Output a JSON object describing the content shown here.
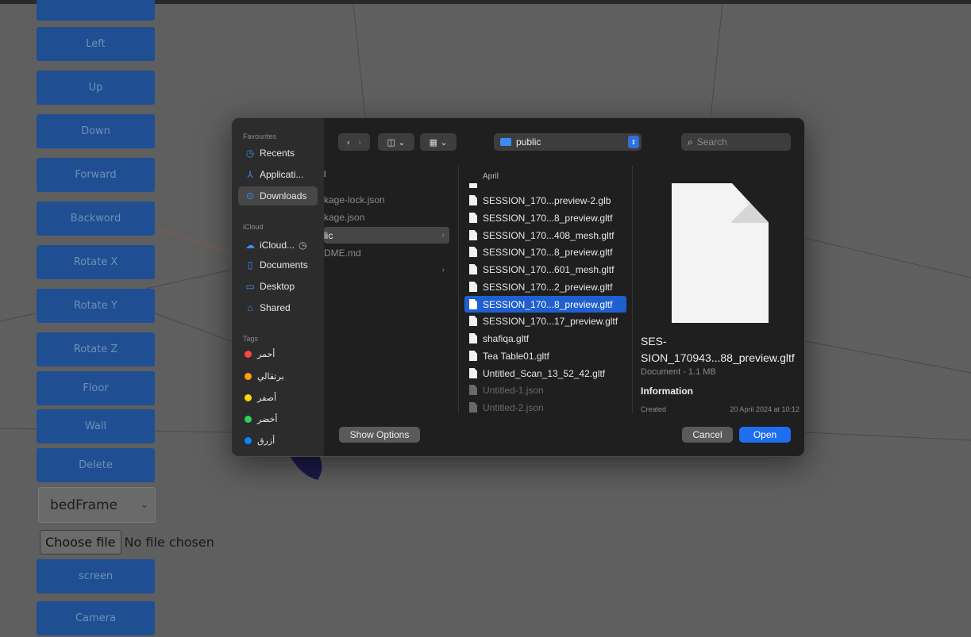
{
  "controls": {
    "buttons": [
      "Left",
      "Up",
      "Down",
      "Forward",
      "Backword",
      "Rotate X",
      "Rotate Y",
      "Rotate Z",
      "Floor",
      "Wall",
      "Delete"
    ],
    "select_value": "bedFrame",
    "choose_file_label": "Choose file",
    "no_file_text": "No file chosen",
    "screen_label": "screen",
    "camera_label": "Camera"
  },
  "dialog": {
    "sidebar": {
      "favourites_heading": "Favourites",
      "favourites": [
        {
          "label": "Recents",
          "icon": "clock-icon"
        },
        {
          "label": "Applicati...",
          "icon": "applications-icon"
        },
        {
          "label": "Downloads",
          "icon": "downloads-icon"
        }
      ],
      "icloud_heading": "iCloud",
      "icloud": [
        {
          "label": "iCloud...",
          "icon": "cloud-icon"
        },
        {
          "label": "Documents",
          "icon": "document-icon"
        },
        {
          "label": "Desktop",
          "icon": "desktop-icon"
        },
        {
          "label": "Shared",
          "icon": "shared-folder-icon"
        }
      ],
      "tags_heading": "Tags",
      "tags": [
        {
          "label": "أحمر",
          "color": "#ff453a"
        },
        {
          "label": "برتقالي",
          "color": "#ff9f0a"
        },
        {
          "label": "أصفر",
          "color": "#ffd60a"
        },
        {
          "label": "أخضر",
          "color": "#30d158"
        },
        {
          "label": "أزرق",
          "color": "#0a84ff"
        }
      ]
    },
    "location": "public",
    "search_placeholder": "Search",
    "column1": {
      "items": [
        {
          "label": "kage-lock.json",
          "selected": false
        },
        {
          "label": "kage.json",
          "selected": false
        },
        {
          "label": "lic",
          "selected": true
        },
        {
          "label": "DME.md",
          "selected": false
        }
      ]
    },
    "column2": {
      "heading": "April",
      "files": [
        {
          "label": "SESSION_170...preview-2.glb",
          "state": "normal"
        },
        {
          "label": "SESSION_170...8_preview.gltf",
          "state": "normal"
        },
        {
          "label": "SESSION_170...408_mesh.gltf",
          "state": "normal"
        },
        {
          "label": "SESSION_170...8_preview.gltf",
          "state": "normal"
        },
        {
          "label": "SESSION_170...601_mesh.gltf",
          "state": "normal"
        },
        {
          "label": "SESSION_170...2_preview.gltf",
          "state": "normal"
        },
        {
          "label": "SESSION_170...8_preview.gltf",
          "state": "selected"
        },
        {
          "label": "SESSION_170...17_preview.gltf",
          "state": "normal"
        },
        {
          "label": "shafiqa.gltf",
          "state": "normal"
        },
        {
          "label": "Tea Table01.gltf",
          "state": "normal"
        },
        {
          "label": "Untitled_Scan_13_52_42.gltf",
          "state": "normal"
        },
        {
          "label": "Untitled-1.json",
          "state": "dim"
        },
        {
          "label": "Untitled-2.json",
          "state": "dim"
        }
      ]
    },
    "preview": {
      "name": "SES-SION_170943...88_preview.gltf",
      "name_line1": "SES-",
      "name_line2": "SION_170943...88_preview.gltf",
      "meta": "Document - 1.1 MB",
      "info_heading": "Information",
      "created_label": "Created",
      "created_value": "20 April 2024 at 10:12"
    },
    "show_options_label": "Show Options",
    "cancel_label": "Cancel",
    "open_label": "Open"
  }
}
